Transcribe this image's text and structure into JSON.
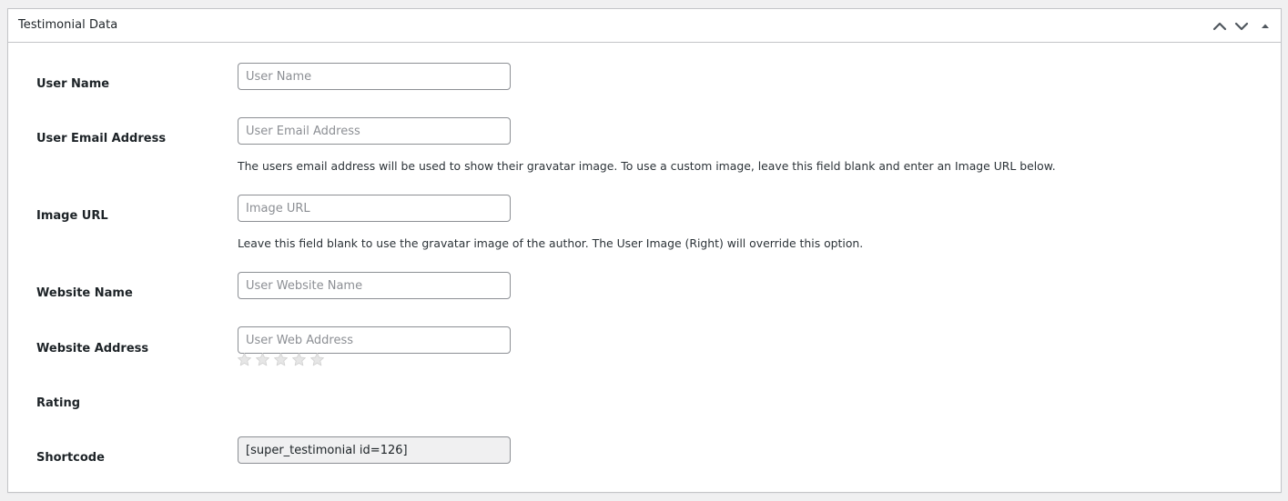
{
  "postbox": {
    "title": "Testimonial Data",
    "actions": {
      "move_up_icon": "chevron-up-icon",
      "move_down_icon": "chevron-down-icon",
      "toggle_icon": "triangle-up-icon"
    }
  },
  "fields": {
    "user_name": {
      "label": "User Name",
      "value": "",
      "placeholder": "User Name"
    },
    "user_email": {
      "label": "User Email Address",
      "value": "",
      "placeholder": "User Email Address",
      "description": "The users email address will be used to show their gravatar image. To use a custom image, leave this field blank and enter an Image URL below."
    },
    "image_url": {
      "label": "Image URL",
      "value": "",
      "placeholder": "Image URL",
      "description": "Leave this field blank to use the gravatar image of the author. The User Image (Right) will override this option."
    },
    "website_name": {
      "label": "Website Name",
      "value": "",
      "placeholder": "User Website Name"
    },
    "website_address": {
      "label": "Website Address",
      "value": "",
      "placeholder": "User Web Address"
    },
    "rating": {
      "label": "Rating",
      "max_stars": 5,
      "selected": 0,
      "star_icon": "star-icon",
      "empty_star_color": "#d3d3d3"
    },
    "shortcode": {
      "label": "Shortcode",
      "value": "[super_testimonial id=126]"
    }
  },
  "colors": {
    "page_background": "#f0f0f1",
    "panel_border": "#c3c4c7",
    "input_border": "#8c8f94",
    "readonly_background": "#f0f0f1",
    "handle_icon": "#50575e"
  }
}
